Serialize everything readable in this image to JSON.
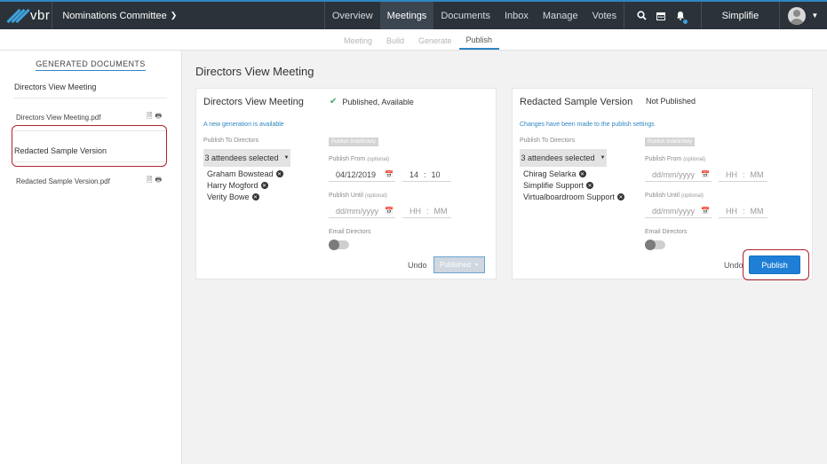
{
  "topbar": {
    "logo_text": "vbr",
    "committee": "Nominations Committee",
    "nav": [
      "Overview",
      "Meetings",
      "Documents",
      "Inbox",
      "Manage",
      "Votes"
    ],
    "user": "Simplifie"
  },
  "icons": {
    "search": "search-icon",
    "calendar": "calendar-icon",
    "bell": "bell-icon",
    "avatar": "user-avatar-icon"
  },
  "subnav": [
    "Meeting",
    "Build",
    "Generate",
    "Publish"
  ],
  "sidebar": {
    "title": "GENERATED DOCUMENTS",
    "groups": [
      {
        "name": "Directors View Meeting",
        "file": "Directors View Meeting.pdf"
      },
      {
        "name": "Redacted Sample Version",
        "file": "Redacted Sample Version.pdf"
      }
    ]
  },
  "main": {
    "title": "Directors View Meeting",
    "common": {
      "publish_to_label": "Publish To Directors",
      "publish_indef": "Publish Indefinitely",
      "publish_from": "Publish From",
      "publish_until": "Publish Until",
      "optional": "(optional)",
      "email_label": "Email Directors",
      "date_ph": "dd/mm/yyyy",
      "hh_ph": "HH",
      "mm_ph": "MM",
      "colon": ":",
      "undo": "Undo"
    },
    "card1": {
      "title": "Directors View Meeting",
      "status": "Published, Available",
      "note": "A new generation is available",
      "attendees_btn": "3 attendees selected",
      "attendees": [
        "Graham Bowstead",
        "Harry Mogford",
        "Verity Bowe"
      ],
      "from_date": "04/12/2019",
      "from_hh": "14",
      "from_mm": "10",
      "action": "Published"
    },
    "card2": {
      "title": "Redacted Sample Version",
      "status": "Not Published",
      "note": "Changes have been made to the publish settings",
      "attendees_btn": "3 attendees selected",
      "attendees": [
        "Chirag Selarka",
        "Simplifie Support",
        "Virtualboardroom Support"
      ],
      "action": "Publish"
    }
  },
  "colors": {
    "topbar": "#2b323a",
    "accent": "#2e86c1",
    "publish_button": "#1f7fd6",
    "highlight": "#b0212f",
    "check": "#3aa76d"
  }
}
